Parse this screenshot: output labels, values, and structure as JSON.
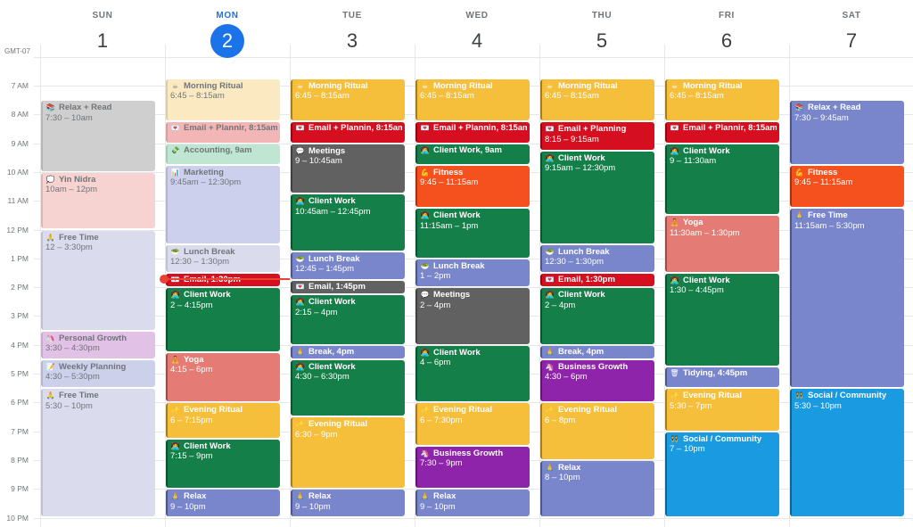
{
  "timezone": "GMT-07",
  "hours": [
    "7 AM",
    "8 AM",
    "9 AM",
    "10 AM",
    "11 AM",
    "12 PM",
    "1 PM",
    "2 PM",
    "3 PM",
    "4 PM",
    "5 PM",
    "6 PM",
    "7 PM",
    "8 PM",
    "9 PM",
    "10 PM"
  ],
  "current_time": "1:45pm",
  "colors": {
    "today": "#1a73e8",
    "now_line": "#ea4335"
  },
  "days": [
    {
      "name": "SUN",
      "num": "1",
      "today": false,
      "events": [
        {
          "title": "Relax + Read",
          "time": "7:30 – 10am",
          "start": 7.5,
          "end": 10,
          "color": "#cfcfcf",
          "faded": true,
          "icon": "books-icon",
          "glyph": "📚"
        },
        {
          "title": "Yin Nidra",
          "time": "10am – 12pm",
          "start": 10,
          "end": 12,
          "color": "#f6d3d1",
          "faded": true,
          "icon": "thought-bubble-icon",
          "glyph": "💭"
        },
        {
          "title": "Free Time",
          "time": "12 – 3:30pm",
          "start": 12,
          "end": 15.5,
          "color": "#dadcee",
          "faded": true,
          "icon": "folded-hands-icon",
          "glyph": "🙏"
        },
        {
          "title": "Personal Growth",
          "time": "3:30 – 4:30pm",
          "start": 15.5,
          "end": 16.5,
          "color": "#e1c2e6",
          "faded": true,
          "icon": "unicorn-icon",
          "glyph": "🦄"
        },
        {
          "title": "Weekly Planning",
          "time": "4:30 – 5:30pm",
          "start": 16.5,
          "end": 17.5,
          "color": "#ccd0ea",
          "faded": true,
          "icon": "memo-icon",
          "glyph": "📝"
        },
        {
          "title": "Free Time",
          "time": "5:30 – 10pm",
          "start": 17.5,
          "end": 22,
          "color": "#dadcee",
          "faded": true,
          "icon": "folded-hands-icon",
          "glyph": "🙏"
        }
      ]
    },
    {
      "name": "MON",
      "num": "2",
      "today": true,
      "events": [
        {
          "title": "Morning Ritual",
          "time": "6:45 – 8:15am",
          "start": 6.75,
          "end": 8.25,
          "color": "#fbeac1",
          "faded": true,
          "icon": "coffee-icon",
          "glyph": "☕"
        },
        {
          "title": "Email + Plannir, 8:15am",
          "time": "",
          "start": 8.25,
          "end": 9,
          "color": "#f3b6b6",
          "faded": true,
          "icon": "love-letter-icon",
          "glyph": "💌",
          "single": true
        },
        {
          "title": "Accounting, 9am",
          "time": "",
          "start": 9,
          "end": 9.75,
          "color": "#bfe6d2",
          "faded": true,
          "icon": "money-icon",
          "glyph": "💸",
          "single": true
        },
        {
          "title": "Marketing",
          "time": "9:45am – 12:30pm",
          "start": 9.75,
          "end": 12.5,
          "color": "#cdd0ec",
          "faded": true,
          "icon": "bar-chart-icon",
          "glyph": "📊"
        },
        {
          "title": "Lunch Break",
          "time": "12:30 – 1:30pm",
          "start": 12.5,
          "end": 13.5,
          "color": "#dadcee",
          "faded": true,
          "icon": "salad-icon",
          "glyph": "🥗"
        },
        {
          "title": "Email, 1:30pm",
          "time": "",
          "start": 13.5,
          "end": 14,
          "color": "#d50f1f",
          "faded": false,
          "icon": "love-letter-icon",
          "glyph": "💌",
          "single": true
        },
        {
          "title": "Client Work",
          "time": "2 – 4:15pm",
          "start": 14,
          "end": 16.25,
          "color": "#157f49",
          "faded": false,
          "icon": "technologist-icon",
          "glyph": "👩‍💻"
        },
        {
          "title": "Yoga",
          "time": "4:15 – 6pm",
          "start": 16.25,
          "end": 18,
          "color": "#e47c75",
          "faded": false,
          "icon": "lotus-position-icon",
          "glyph": "🧘"
        },
        {
          "title": "Evening Ritual",
          "time": "6 – 7:15pm",
          "start": 18,
          "end": 19.25,
          "color": "#f5bf3c",
          "faded": false,
          "icon": "sparkles-icon",
          "glyph": "✨"
        },
        {
          "title": "Client Work",
          "time": "7:15 – 9pm",
          "start": 19.25,
          "end": 21,
          "color": "#157f49",
          "faded": false,
          "icon": "technologist-icon",
          "glyph": "👩‍💻"
        },
        {
          "title": "Relax",
          "time": "9 – 10pm",
          "start": 21,
          "end": 22,
          "color": "#7986cb",
          "faded": false,
          "icon": "folded-hands-icon",
          "glyph": "🙏"
        }
      ]
    },
    {
      "name": "TUE",
      "num": "3",
      "today": false,
      "events": [
        {
          "title": "Morning Ritual",
          "time": "6:45 – 8:15am",
          "start": 6.75,
          "end": 8.25,
          "color": "#f5bf3c",
          "faded": false,
          "icon": "coffee-icon",
          "glyph": "☕"
        },
        {
          "title": "Email + Plannin, 8:15am",
          "time": "",
          "start": 8.25,
          "end": 9,
          "color": "#d50f1f",
          "faded": false,
          "icon": "love-letter-icon",
          "glyph": "💌",
          "single": true
        },
        {
          "title": "Meetings",
          "time": "9 – 10:45am",
          "start": 9,
          "end": 10.75,
          "color": "#616161",
          "faded": false,
          "icon": "speech-bubble-icon",
          "glyph": "💬"
        },
        {
          "title": "Client Work",
          "time": "10:45am – 12:45pm",
          "start": 10.75,
          "end": 12.75,
          "color": "#157f49",
          "faded": false,
          "icon": "technologist-icon",
          "glyph": "👩‍💻"
        },
        {
          "title": "Lunch Break",
          "time": "12:45 – 1:45pm",
          "start": 12.75,
          "end": 13.75,
          "color": "#7986cb",
          "faded": false,
          "icon": "salad-icon",
          "glyph": "🥗"
        },
        {
          "title": "Email, 1:45pm",
          "time": "",
          "start": 13.75,
          "end": 14.25,
          "color": "#616161",
          "faded": false,
          "icon": "love-letter-icon",
          "glyph": "💌",
          "single": true
        },
        {
          "title": "Client Work",
          "time": "2:15 – 4pm",
          "start": 14.25,
          "end": 16,
          "color": "#157f49",
          "faded": false,
          "icon": "technologist-icon",
          "glyph": "👩‍💻"
        },
        {
          "title": "Break, 4pm",
          "time": "",
          "start": 16,
          "end": 16.5,
          "color": "#7986cb",
          "faded": false,
          "icon": "folded-hands-icon",
          "glyph": "🙏",
          "single": true
        },
        {
          "title": "Client Work",
          "time": "4:30 – 6:30pm",
          "start": 16.5,
          "end": 18.5,
          "color": "#157f49",
          "faded": false,
          "icon": "technologist-icon",
          "glyph": "👩‍💻"
        },
        {
          "title": "Evening Ritual",
          "time": "6:30 – 9pm",
          "start": 18.5,
          "end": 21,
          "color": "#f5bf3c",
          "faded": false,
          "icon": "sparkles-icon",
          "glyph": "✨"
        },
        {
          "title": "Relax",
          "time": "9 – 10pm",
          "start": 21,
          "end": 22,
          "color": "#7986cb",
          "faded": false,
          "icon": "folded-hands-icon",
          "glyph": "🙏"
        }
      ]
    },
    {
      "name": "WED",
      "num": "4",
      "today": false,
      "events": [
        {
          "title": "Morning Ritual",
          "time": "6:45 – 8:15am",
          "start": 6.75,
          "end": 8.25,
          "color": "#f5bf3c",
          "faded": false,
          "icon": "coffee-icon",
          "glyph": "☕"
        },
        {
          "title": "Email + Plannin, 8:15am",
          "time": "",
          "start": 8.25,
          "end": 9,
          "color": "#d50f1f",
          "faded": false,
          "icon": "love-letter-icon",
          "glyph": "💌",
          "single": true
        },
        {
          "title": "Client Work, 9am",
          "time": "",
          "start": 9,
          "end": 9.75,
          "color": "#157f49",
          "faded": false,
          "icon": "technologist-icon",
          "glyph": "👩‍💻",
          "single": true
        },
        {
          "title": "Fitness",
          "time": "9:45 – 11:15am",
          "start": 9.75,
          "end": 11.25,
          "color": "#f4511e",
          "faded": false,
          "icon": "flexed-biceps-icon",
          "glyph": "💪"
        },
        {
          "title": "Client Work",
          "time": "11:15am – 1pm",
          "start": 11.25,
          "end": 13,
          "color": "#157f49",
          "faded": false,
          "icon": "technologist-icon",
          "glyph": "👩‍💻"
        },
        {
          "title": "Lunch Break",
          "time": "1 – 2pm",
          "start": 13,
          "end": 14,
          "color": "#7986cb",
          "faded": false,
          "icon": "salad-icon",
          "glyph": "🥗"
        },
        {
          "title": "Meetings",
          "time": "2 – 4pm",
          "start": 14,
          "end": 16,
          "color": "#616161",
          "faded": false,
          "icon": "speech-bubble-icon",
          "glyph": "💬"
        },
        {
          "title": "Client Work",
          "time": "4 – 6pm",
          "start": 16,
          "end": 18,
          "color": "#157f49",
          "faded": false,
          "icon": "technologist-icon",
          "glyph": "👩‍💻"
        },
        {
          "title": "Evening Ritual",
          "time": "6 – 7:30pm",
          "start": 18,
          "end": 19.5,
          "color": "#f5bf3c",
          "faded": false,
          "icon": "sparkles-icon",
          "glyph": "✨"
        },
        {
          "title": "Business Growth",
          "time": "7:30 – 9pm",
          "start": 19.5,
          "end": 21,
          "color": "#8e24aa",
          "faded": false,
          "icon": "unicorn-icon",
          "glyph": "🦄"
        },
        {
          "title": "Relax",
          "time": "9 – 10pm",
          "start": 21,
          "end": 22,
          "color": "#7986cb",
          "faded": false,
          "icon": "folded-hands-icon",
          "glyph": "🙏"
        }
      ]
    },
    {
      "name": "THU",
      "num": "5",
      "today": false,
      "events": [
        {
          "title": "Morning Ritual",
          "time": "6:45 – 8:15am",
          "start": 6.75,
          "end": 8.25,
          "color": "#f5bf3c",
          "faded": false,
          "icon": "coffee-icon",
          "glyph": "☕"
        },
        {
          "title": "Email + Planning",
          "time": "8:15 – 9:15am",
          "start": 8.25,
          "end": 9.25,
          "color": "#d50f1f",
          "faded": false,
          "icon": "love-letter-icon",
          "glyph": "💌"
        },
        {
          "title": "Client Work",
          "time": "9:15am – 12:30pm",
          "start": 9.25,
          "end": 12.5,
          "color": "#157f49",
          "faded": false,
          "icon": "technologist-icon",
          "glyph": "👩‍💻"
        },
        {
          "title": "Lunch Break",
          "time": "12:30 – 1:30pm",
          "start": 12.5,
          "end": 13.5,
          "color": "#7986cb",
          "faded": false,
          "icon": "salad-icon",
          "glyph": "🥗"
        },
        {
          "title": "Email, 1:30pm",
          "time": "",
          "start": 13.5,
          "end": 14,
          "color": "#d50f1f",
          "faded": false,
          "icon": "love-letter-icon",
          "glyph": "💌",
          "single": true
        },
        {
          "title": "Client Work",
          "time": "2 – 4pm",
          "start": 14,
          "end": 16,
          "color": "#157f49",
          "faded": false,
          "icon": "technologist-icon",
          "glyph": "👩‍💻"
        },
        {
          "title": "Break, 4pm",
          "time": "",
          "start": 16,
          "end": 16.5,
          "color": "#7986cb",
          "faded": false,
          "icon": "folded-hands-icon",
          "glyph": "🙏",
          "single": true
        },
        {
          "title": "Business Growth",
          "time": "4:30 – 6pm",
          "start": 16.5,
          "end": 18,
          "color": "#8e24aa",
          "faded": false,
          "icon": "unicorn-icon",
          "glyph": "🦄"
        },
        {
          "title": "Evening Ritual",
          "time": "6 – 8pm",
          "start": 18,
          "end": 20,
          "color": "#f5bf3c",
          "faded": false,
          "icon": "sparkles-icon",
          "glyph": "✨"
        },
        {
          "title": "Relax",
          "time": "8 – 10pm",
          "start": 20,
          "end": 22,
          "color": "#7986cb",
          "faded": false,
          "icon": "folded-hands-icon",
          "glyph": "🙏"
        }
      ]
    },
    {
      "name": "FRI",
      "num": "6",
      "today": false,
      "events": [
        {
          "title": "Morning Ritual",
          "time": "6:45 – 8:15am",
          "start": 6.75,
          "end": 8.25,
          "color": "#f5bf3c",
          "faded": false,
          "icon": "coffee-icon",
          "glyph": "☕"
        },
        {
          "title": "Email + Plannir, 8:15am",
          "time": "",
          "start": 8.25,
          "end": 9,
          "color": "#d50f1f",
          "faded": false,
          "icon": "love-letter-icon",
          "glyph": "💌",
          "single": true
        },
        {
          "title": "Client Work",
          "time": "9 – 11:30am",
          "start": 9,
          "end": 11.5,
          "color": "#157f49",
          "faded": false,
          "icon": "technologist-icon",
          "glyph": "👩‍💻"
        },
        {
          "title": "Yoga",
          "time": "11:30am – 1:30pm",
          "start": 11.5,
          "end": 13.5,
          "color": "#e47c75",
          "faded": false,
          "icon": "lotus-position-icon",
          "glyph": "🧘"
        },
        {
          "title": "Client Work",
          "time": "1:30 – 4:45pm",
          "start": 13.5,
          "end": 16.75,
          "color": "#157f49",
          "faded": false,
          "icon": "technologist-icon",
          "glyph": "👩‍💻"
        },
        {
          "title": "Tidying, 4:45pm",
          "time": "",
          "start": 16.75,
          "end": 17.5,
          "color": "#7986cb",
          "faded": false,
          "icon": "wastebasket-icon",
          "glyph": "🗑",
          "single": true
        },
        {
          "title": "Evening Ritual",
          "time": "5:30 – 7pm",
          "start": 17.5,
          "end": 19,
          "color": "#f5bf3c",
          "faded": false,
          "icon": "sparkles-icon",
          "glyph": "✨"
        },
        {
          "title": "Social / Community",
          "time": "7 – 10pm",
          "start": 19,
          "end": 22,
          "color": "#1a9ae0",
          "faded": false,
          "icon": "people-icon",
          "glyph": "👯"
        }
      ]
    },
    {
      "name": "SAT",
      "num": "7",
      "today": false,
      "events": [
        {
          "title": "Relax + Read",
          "time": "7:30 – 9:45am",
          "start": 7.5,
          "end": 9.75,
          "color": "#7986cb",
          "faded": false,
          "icon": "books-icon",
          "glyph": "📚"
        },
        {
          "title": "Fitness",
          "time": "9:45 – 11:15am",
          "start": 9.75,
          "end": 11.25,
          "color": "#f4511e",
          "faded": false,
          "icon": "flexed-biceps-icon",
          "glyph": "💪"
        },
        {
          "title": "Free Time",
          "time": "11:15am – 5:30pm",
          "start": 11.25,
          "end": 17.5,
          "color": "#7986cb",
          "faded": false,
          "icon": "folded-hands-icon",
          "glyph": "🙏"
        },
        {
          "title": "Social / Community",
          "time": "5:30 – 10pm",
          "start": 17.5,
          "end": 22,
          "color": "#1a9ae0",
          "faded": false,
          "icon": "people-icon",
          "glyph": "👯"
        }
      ]
    }
  ]
}
